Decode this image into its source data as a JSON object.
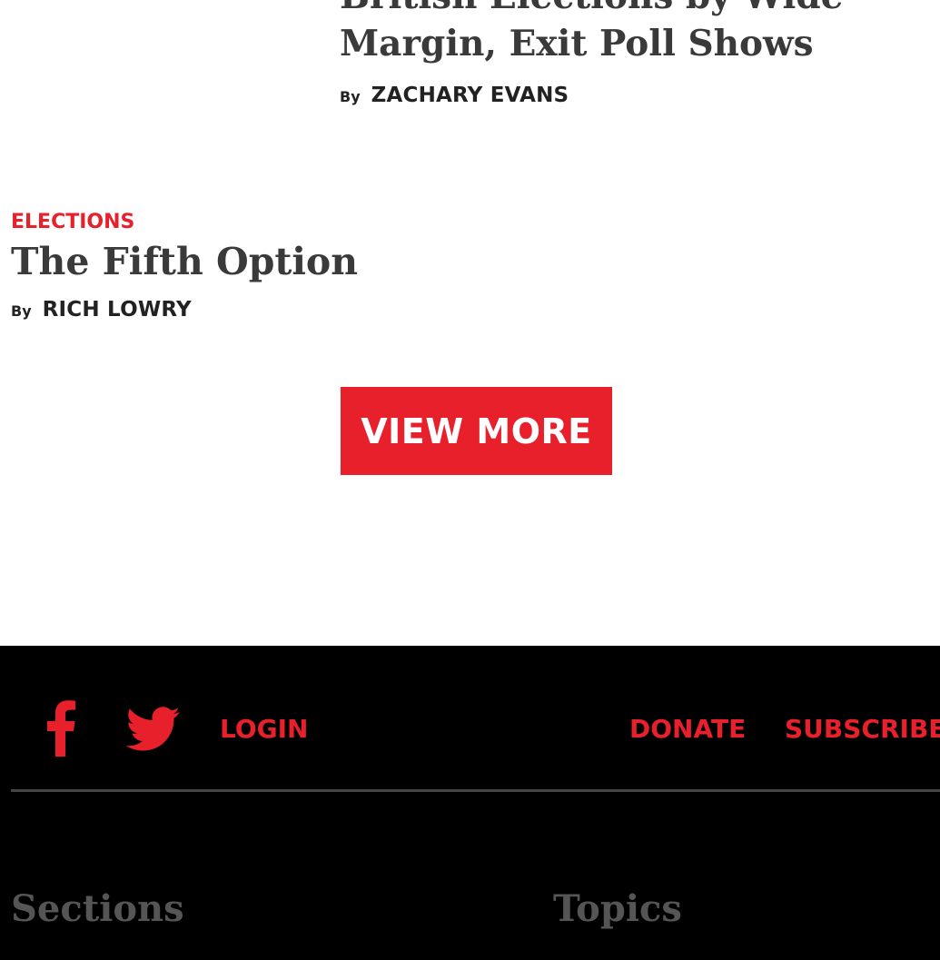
{
  "articles": [
    {
      "headline_line1": "British Elections by Wide",
      "headline_line2": "Margin, Exit Poll Shows",
      "by": "By",
      "author": "ZACHARY EVANS"
    },
    {
      "category": "ELECTIONS",
      "headline": "The Fifth Option",
      "by": "By",
      "author": "RICH LOWRY"
    }
  ],
  "view_more_label": "VIEW MORE",
  "footer": {
    "social_icons": [
      "facebook-icon",
      "twitter-icon"
    ],
    "login_label": "LOGIN",
    "donate_label": "DONATE",
    "subscribe_label": "SUBSCRIBE",
    "sections_heading": "Sections",
    "topics_heading": "Topics"
  },
  "colors": {
    "accent": "#e8202c",
    "footer_bg": "#000000",
    "headline": "#3a3a3a",
    "footer_heading": "#555555"
  }
}
